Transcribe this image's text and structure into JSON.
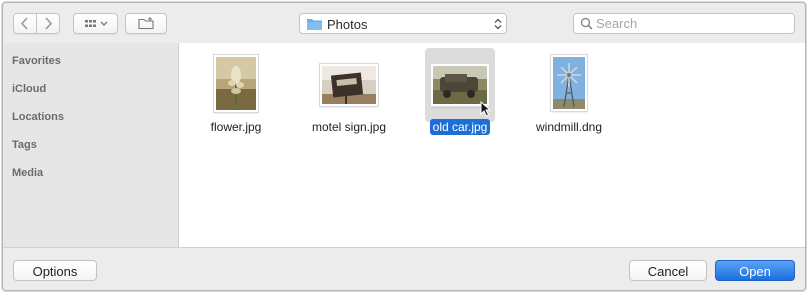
{
  "toolbar": {
    "back_icon": "chevron-left-icon",
    "forward_icon": "chevron-right-icon",
    "view_icon": "grid-view-icon",
    "new_folder_icon": "new-folder-icon",
    "location": "Photos",
    "location_icon": "folder-icon",
    "search_placeholder": "Search",
    "search_value": ""
  },
  "sidebar": {
    "sections": [
      {
        "label": "Favorites"
      },
      {
        "label": "iCloud"
      },
      {
        "label": "Locations"
      },
      {
        "label": "Tags"
      },
      {
        "label": "Media"
      }
    ]
  },
  "files": [
    {
      "name": "flower.jpg",
      "thumbnail": "flower-photo",
      "selected": false
    },
    {
      "name": "motel sign.jpg",
      "thumbnail": "motel-sign-photo",
      "selected": false
    },
    {
      "name": "old car.jpg",
      "thumbnail": "old-car-photo",
      "selected": true
    },
    {
      "name": "windmill.dng",
      "thumbnail": "windmill-photo",
      "selected": false
    }
  ],
  "footer": {
    "options_label": "Options",
    "cancel_label": "Cancel",
    "open_label": "Open"
  },
  "colors": {
    "accent": "#1f6ed6",
    "selection_bg": "#dcdcdc",
    "sidebar_text": "#6b6b6b"
  }
}
